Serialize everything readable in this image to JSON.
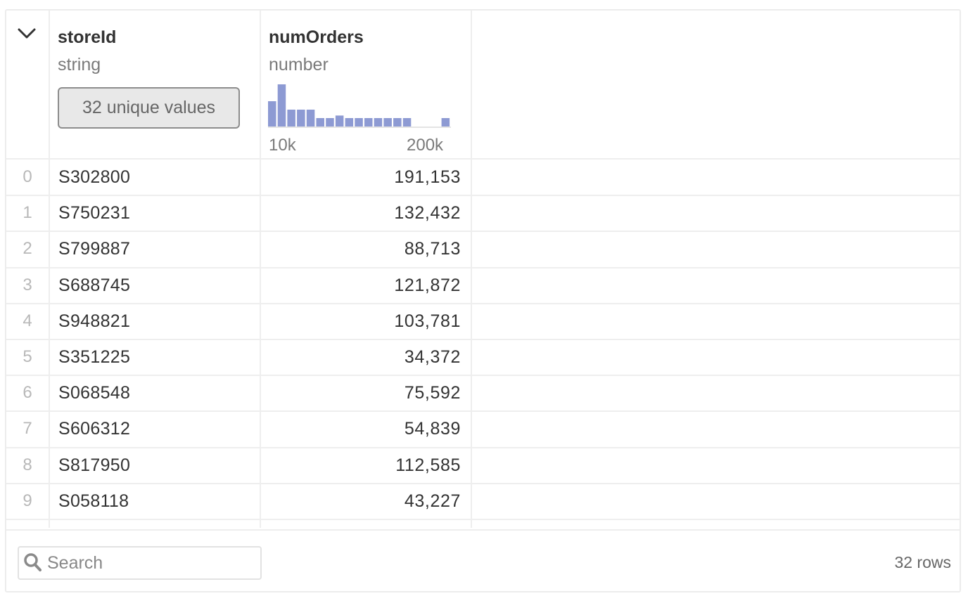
{
  "columns": [
    {
      "name": "storeId",
      "type": "string",
      "summary_button": "32 unique values"
    },
    {
      "name": "numOrders",
      "type": "number",
      "histogram": {
        "min_label": "10k",
        "max_label": "200k",
        "bar_color": "#8d9ad3",
        "relative_counts": [
          3,
          5,
          2,
          2,
          2,
          1,
          1,
          1.3,
          1,
          1,
          1,
          1,
          1,
          1,
          1,
          0,
          0,
          0,
          1
        ]
      }
    }
  ],
  "rows": [
    {
      "index": "0",
      "storeId": "S302800",
      "numOrders": "191,153"
    },
    {
      "index": "1",
      "storeId": "S750231",
      "numOrders": "132,432"
    },
    {
      "index": "2",
      "storeId": "S799887",
      "numOrders": "88,713"
    },
    {
      "index": "3",
      "storeId": "S688745",
      "numOrders": "121,872"
    },
    {
      "index": "4",
      "storeId": "S948821",
      "numOrders": "103,781"
    },
    {
      "index": "5",
      "storeId": "S351225",
      "numOrders": "34,372"
    },
    {
      "index": "6",
      "storeId": "S068548",
      "numOrders": "75,592"
    },
    {
      "index": "7",
      "storeId": "S606312",
      "numOrders": "54,839"
    },
    {
      "index": "8",
      "storeId": "S817950",
      "numOrders": "112,585"
    },
    {
      "index": "9",
      "storeId": "S058118",
      "numOrders": "43,227"
    }
  ],
  "footer": {
    "search_placeholder": "Search",
    "row_count": "32 rows"
  },
  "icons": {
    "collapse": "chevron-down-icon",
    "search": "search-icon"
  }
}
